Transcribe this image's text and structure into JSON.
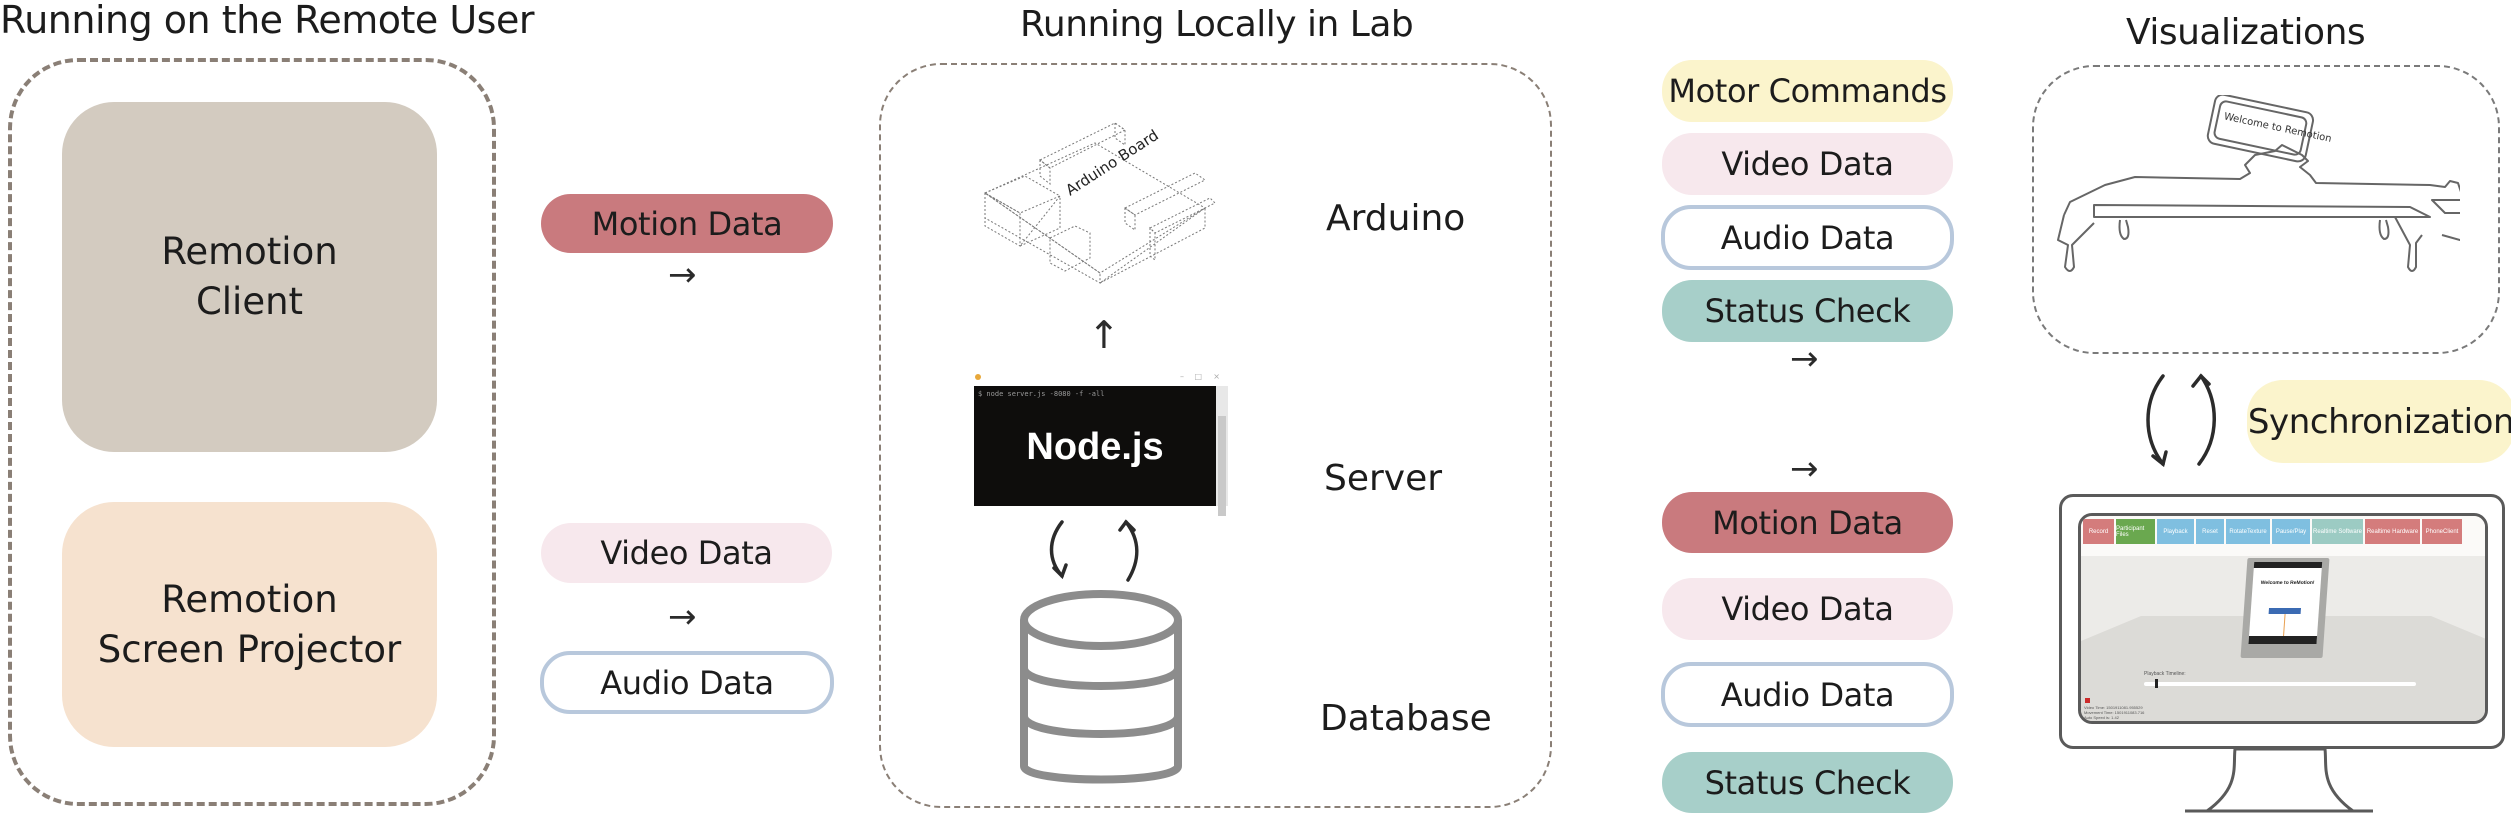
{
  "sections": {
    "remote_user": {
      "title": "Running on the Remote User"
    },
    "lab": {
      "title": "Running Locally in Lab"
    },
    "visualizations": {
      "title": "Visualizations"
    }
  },
  "remote_components": [
    {
      "line1": "Remotion",
      "line2": "Client",
      "color": "#d3cbc0"
    },
    {
      "line1": "Remotion",
      "line2": "Screen Projector",
      "color": "#f6e2cf"
    }
  ],
  "remote_to_lab": {
    "top": [
      {
        "label": "Motion Data",
        "type": "motion"
      }
    ],
    "bottom": [
      {
        "label": "Video Data",
        "type": "video"
      },
      {
        "label": "Audio Data",
        "type": "audio"
      }
    ],
    "arrow": "→"
  },
  "lab": {
    "arduino": {
      "label": "Arduino",
      "board_label": "Arduino Board"
    },
    "server": {
      "label": "Server",
      "terminal_command": "$ node server.js -8080 -f -all",
      "terminal_title": "Node.js"
    },
    "database": {
      "label": "Database"
    },
    "up_arrow": "↑"
  },
  "lab_to_vis": {
    "top": [
      {
        "label": "Motor Commands",
        "type": "motor"
      },
      {
        "label": "Video Data",
        "type": "video"
      },
      {
        "label": "Audio Data",
        "type": "audio"
      },
      {
        "label": "Status Check",
        "type": "status"
      }
    ],
    "bottom": [
      {
        "label": "Motion Data",
        "type": "motion"
      },
      {
        "label": "Video Data",
        "type": "video"
      },
      {
        "label": "Audio Data",
        "type": "audio"
      },
      {
        "label": "Status Check",
        "type": "status"
      }
    ],
    "arrow": "→"
  },
  "visualization": {
    "robot_screen_text": "Welcome to Remotion",
    "sync_label": "Synchronization",
    "app": {
      "buttons": [
        {
          "label": "Record",
          "color": "#d47c7c"
        },
        {
          "label": "Participant Files",
          "color": "#6aa84f"
        },
        {
          "label": "Playback",
          "color": "#7fbfe0"
        },
        {
          "label": "Reset",
          "color": "#7fbfe0"
        },
        {
          "label": "RotateTexture",
          "color": "#7fbfe0"
        },
        {
          "label": "Pause/Play",
          "color": "#7fbfe0"
        },
        {
          "label": "Realtime Software",
          "color": "#9ccbc3"
        },
        {
          "label": "Realtime Hardware",
          "color": "#d47c7c"
        },
        {
          "label": "PhoneClient",
          "color": "#d47c7c"
        }
      ],
      "phone_heading": "Welcome to ReMotion!",
      "playback_label": "Playback Timeline:",
      "playback_position": 0.04,
      "video_time": "Video Time: 1501911081.955529",
      "movement_time": "Movement Time: 1501911083.716",
      "auto_speed": "Auto Speed is: 1.42"
    }
  }
}
